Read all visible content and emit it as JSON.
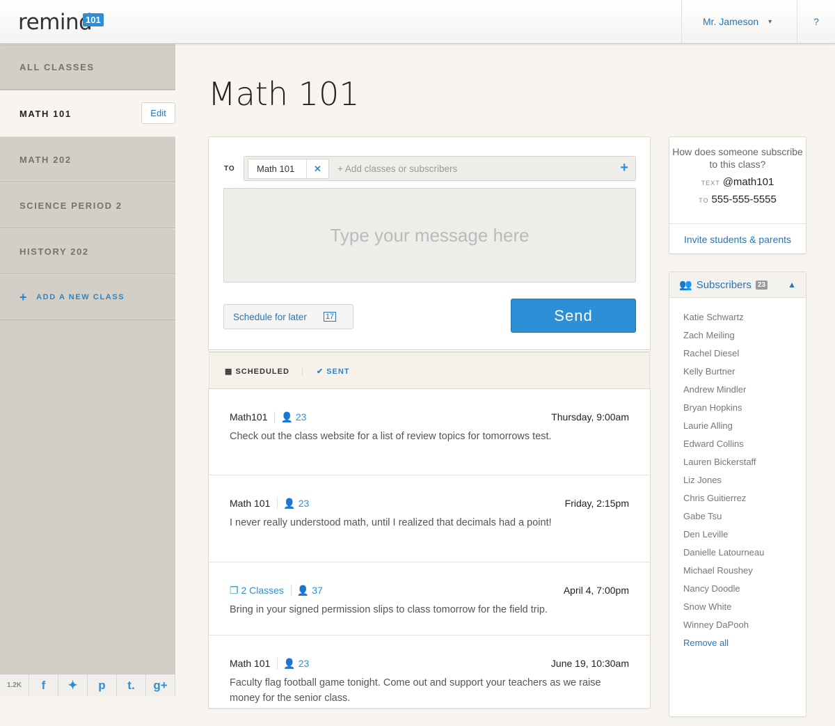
{
  "header": {
    "logo": "remind",
    "logo_badge": "101",
    "user": "Mr. Jameson",
    "help": "?"
  },
  "sidebar": {
    "items": [
      {
        "label": "ALL CLASSES"
      },
      {
        "label": "MATH 101"
      },
      {
        "label": "MATH 202"
      },
      {
        "label": "SCIENCE PERIOD 2"
      },
      {
        "label": "HISTORY 202"
      }
    ],
    "edit": "Edit",
    "add": "ADD A NEW CLASS",
    "share_count": "1.2K",
    "social": [
      "f",
      "t",
      "p",
      "t.",
      "g+"
    ]
  },
  "page": {
    "title": "Math 101"
  },
  "compose": {
    "to": "TO",
    "chip": "Math 101",
    "placeholder_to": "+ Add classes or subscribers",
    "placeholder_msg": "Type your message here",
    "schedule": "Schedule for later",
    "send": "Send"
  },
  "tabs": {
    "scheduled": "SCHEDULED",
    "sent": "SENT"
  },
  "messages": [
    {
      "to": "Math101",
      "count": "23",
      "date": "Thursday, 9:00am",
      "text": "Check out the class website for a list of review topics for tomorrows test."
    },
    {
      "to": "Math 101",
      "count": "23",
      "date": "Friday, 2:15pm",
      "text": "I never really understood math, until I realized that decimals had a point!"
    },
    {
      "to": "2 Classes",
      "count": "37",
      "date": "April 4, 7:00pm",
      "text": "Bring in your signed permission slips to class tomorrow for the field trip."
    },
    {
      "to": "Math 101",
      "count": "23",
      "date": "June 19, 10:30am",
      "text": "Faculty flag football game tonight.  Come out and support your teachers as we raise money for the senior class."
    }
  ],
  "subscribe": {
    "question": "How does someone subscribe to this class?",
    "text_label": "TEXT",
    "text_value": "@math101",
    "to_label": "TO",
    "to_value": "555-555-5555",
    "invite": "Invite students & parents"
  },
  "subscribers": {
    "title": "Subscribers",
    "count": "23",
    "names": [
      "Katie Schwartz",
      "Zach Meiling",
      "Rachel Diesel",
      "Kelly Burtner",
      "Andrew Mindler",
      "Bryan Hopkins",
      "Laurie Alling",
      "Edward Collins",
      "Lauren Bickerstaff",
      "Liz Jones",
      "Chris Guitierrez",
      "Gabe Tsu",
      "Den Leville",
      "Danielle Latourneau",
      "Michael Roushey",
      "Nancy Doodle",
      "Snow White",
      "Winney DaPooh"
    ],
    "remove": "Remove all"
  }
}
